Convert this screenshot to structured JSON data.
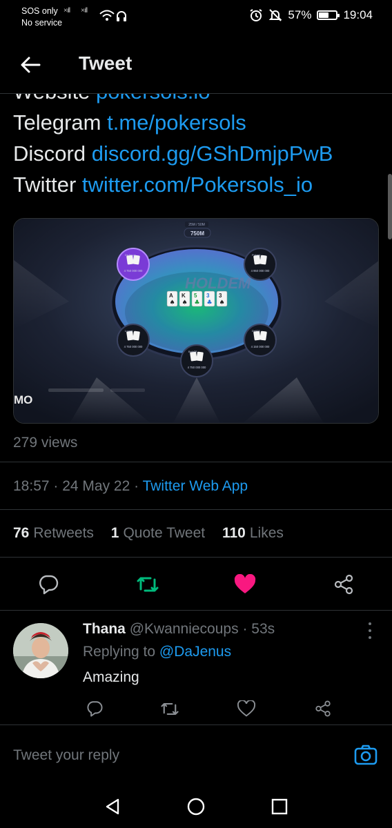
{
  "status_bar": {
    "carrier_line1": "SOS only",
    "carrier_line2": "No service",
    "battery_text": "57%",
    "battery_level": 0.57,
    "time": "19:04"
  },
  "header": {
    "title": "Tweet"
  },
  "tweet": {
    "links": [
      {
        "label": "Website",
        "value": "pokersols.io"
      },
      {
        "label": "Telegram",
        "value": "t.me/pokersols"
      },
      {
        "label": "Discord",
        "value": "discord.gg/GShDmjpPwB"
      },
      {
        "label": "Twitter",
        "value": "twitter.com/Pokersols_io"
      }
    ],
    "media": {
      "pot_small": "25M / 50M",
      "pot": "750M",
      "table_logo": "HOLDEM",
      "watermark": "MO",
      "seats": [
        {
          "name": "DaJenus",
          "chips": "4 750 000 000"
        },
        {
          "name": "Pokerk",
          "chips": "4 950 000 000"
        },
        {
          "name": "Lorent",
          "chips": "4 750 000 000"
        },
        {
          "name": "Delf73",
          "chips": "4 150 000 000"
        },
        {
          "name": "Bola78",
          "chips": "4 750 000 000"
        }
      ],
      "community_cards": [
        "A",
        "K",
        "5",
        "3",
        "3"
      ]
    },
    "views": "279 views",
    "time": "18:57",
    "date": "24 May 22",
    "source": "Twitter Web App",
    "stats": {
      "retweets_count": "76",
      "retweets_label": "Retweets",
      "quotes_count": "1",
      "quotes_label": "Quote Tweet",
      "likes_count": "110",
      "likes_label": "Likes"
    },
    "colors": {
      "retweet": "#00ba7c",
      "like": "#f91880",
      "link": "#1d9bf0"
    }
  },
  "reply": {
    "name": "Thana",
    "handle": "@Kwanniecoups",
    "age": "53s",
    "replying_label": "Replying to",
    "replying_to": "@DaJenus",
    "text": "Amazing"
  },
  "compose": {
    "placeholder": "Tweet your reply"
  },
  "icons": [
    "back-arrow-icon",
    "reply-icon",
    "retweet-icon",
    "heart-icon",
    "share-icon",
    "more-icon",
    "camera-icon",
    "nav-back-icon",
    "nav-home-icon",
    "nav-recents-icon"
  ]
}
